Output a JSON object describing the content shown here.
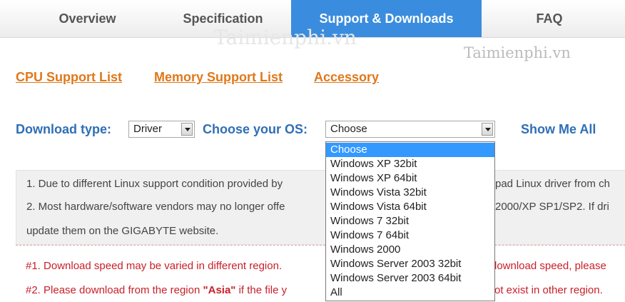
{
  "tabs": [
    {
      "label": "Overview"
    },
    {
      "label": "Specification"
    },
    {
      "label": "Support & Downloads"
    },
    {
      "label": "FAQ"
    }
  ],
  "active_tab_color": "#3a8dde",
  "watermark": "Taimienphi.vn",
  "sublinks": [
    "CPU Support List",
    "Memory Support List",
    "Accessory"
  ],
  "filters": {
    "download_type_label": "Download type:",
    "download_type_value": "Driver",
    "os_label": "Choose your OS:",
    "os_value": "Choose",
    "show_all": "Show Me All"
  },
  "os_options": [
    "Choose",
    "Windows XP 32bit",
    "Windows XP 64bit",
    "Windows Vista 32bit",
    "Windows Vista 64bit",
    "Windows 7 32bit",
    "Windows 7 64bit",
    "Windows 2000",
    "Windows Server 2003 32bit",
    "Windows Server 2003 64bit",
    "All"
  ],
  "notes": {
    "line1_left": "1. Due to different Linux support condition provided by",
    "line1_right": "pad Linux driver from ch",
    "line2_left": "2. Most hardware/software vendors may no longer offe",
    "line2_right": "2000/XP SP1/SP2. If dri",
    "line3": "update them on the GIGABYTE website."
  },
  "warnings": {
    "w1_left": "#1. Download speed may be varied in different region.",
    "w1_right": "lownload speed, please",
    "w2_left": "#2. Please download from the region",
    "w2_bold": "\"Asia\"",
    "w2_mid": "if the file y",
    "w2_right": "ot exist in other region."
  }
}
